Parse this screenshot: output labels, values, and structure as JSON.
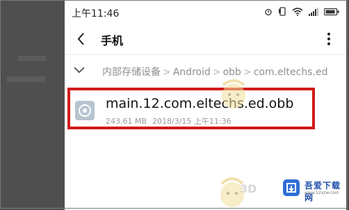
{
  "status_bar": {
    "time": "上午11:46",
    "icons": [
      "alarm-icon",
      "vibrate-icon",
      "wifi-icon",
      "signal-icon",
      "battery-icon"
    ]
  },
  "title_bar": {
    "title": "手机",
    "back_icon": "chevron-left-icon",
    "more_icon": "more-vertical-icon"
  },
  "breadcrumb": {
    "items": [
      "内部存储设备",
      "Android",
      "obb",
      "com.eltechs.ed"
    ]
  },
  "file": {
    "name": "main.12.com.eltechs.ed.obb",
    "size": "243.61 MB",
    "date": "2018/3/15",
    "time": "上午11:36",
    "icon": "file-icon",
    "highlight_color": "#d11a1a"
  },
  "watermark": {
    "site_name": "吾爱下载网",
    "site_url": "www.52xzw.com",
    "mark": "3D"
  }
}
